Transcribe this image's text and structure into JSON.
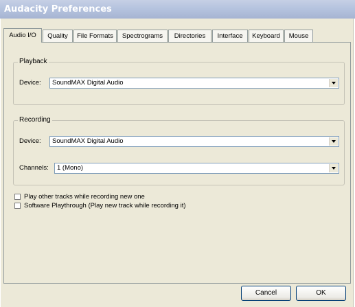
{
  "window": {
    "title": "Audacity Preferences"
  },
  "tabs": [
    {
      "label": "Audio I/O",
      "active": true
    },
    {
      "label": "Quality"
    },
    {
      "label": "File Formats"
    },
    {
      "label": "Spectrograms"
    },
    {
      "label": "Directories"
    },
    {
      "label": "Interface"
    },
    {
      "label": "Keyboard"
    },
    {
      "label": "Mouse"
    }
  ],
  "playback": {
    "group_label": "Playback",
    "device_label": "Device:",
    "device_value": "SoundMAX Digital Audio"
  },
  "recording": {
    "group_label": "Recording",
    "device_label": "Device:",
    "device_value": "SoundMAX Digital Audio",
    "channels_label": "Channels:",
    "channels_value": "1 (Mono)"
  },
  "options": {
    "play_other_tracks": {
      "label": "Play other tracks while recording new one",
      "checked": false
    },
    "software_playthrough": {
      "label": "Software Playthrough (Play new track while recording it)",
      "checked": false
    }
  },
  "buttons": {
    "cancel": "Cancel",
    "ok": "OK"
  },
  "colors": {
    "dialog_bg": "#ece9d8",
    "title_text": "#ffffff",
    "combo_border": "#7f9db9"
  }
}
